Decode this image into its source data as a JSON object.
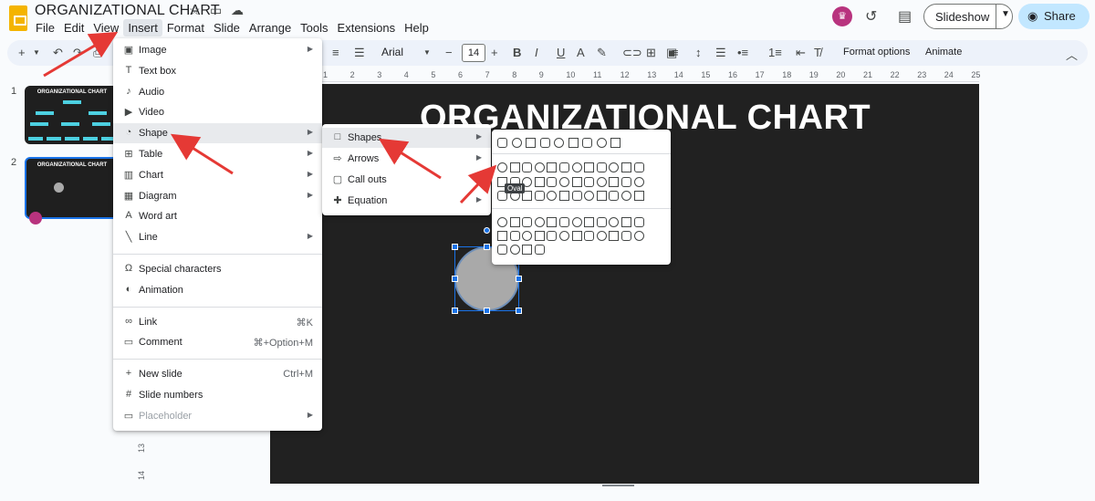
{
  "app": {
    "title": "ORGANIZATIONAL CHART",
    "menu": [
      "File",
      "Edit",
      "View",
      "Insert",
      "Format",
      "Slide",
      "Arrange",
      "Tools",
      "Extensions",
      "Help"
    ],
    "slideshow_label": "Slideshow",
    "share_label": "Share"
  },
  "toolbar": {
    "font": "Arial",
    "font_size": "14",
    "format_options": "Format options",
    "animate": "Animate"
  },
  "rulers": {
    "horizontal": [
      "1",
      "2",
      "3",
      "4",
      "5",
      "6",
      "7",
      "8",
      "9",
      "10",
      "11",
      "12",
      "13",
      "14",
      "15",
      "16",
      "17",
      "18",
      "19",
      "20",
      "21",
      "22",
      "23",
      "24",
      "25"
    ],
    "vertical": [
      "13",
      "14"
    ]
  },
  "filmstrip": {
    "slides": [
      {
        "number": "1",
        "title": "ORGANIZATIONAL CHART"
      },
      {
        "number": "2",
        "title": "ORGANIZATIONAL CHART"
      }
    ]
  },
  "slide": {
    "title": "ORGANIZATIONAL CHART"
  },
  "insert_menu": {
    "groups": [
      [
        {
          "label": "Image",
          "icon": "image-icon",
          "submenu": true
        },
        {
          "label": "Text box",
          "icon": "text-box-icon"
        },
        {
          "label": "Audio",
          "icon": "audio-icon"
        },
        {
          "label": "Video",
          "icon": "video-icon"
        },
        {
          "label": "Shape",
          "icon": "shape-icon",
          "submenu": true,
          "highlighted": true
        },
        {
          "label": "Table",
          "icon": "table-icon",
          "submenu": true
        },
        {
          "label": "Chart",
          "icon": "chart-icon",
          "submenu": true
        },
        {
          "label": "Diagram",
          "icon": "diagram-icon",
          "submenu": true
        },
        {
          "label": "Word art",
          "icon": "word-art-icon"
        },
        {
          "label": "Line",
          "icon": "line-icon",
          "submenu": true
        }
      ],
      [
        {
          "label": "Special characters",
          "icon": "omega-icon"
        },
        {
          "label": "Animation",
          "icon": "animation-icon"
        }
      ],
      [
        {
          "label": "Link",
          "icon": "link-icon",
          "shortcut": "⌘K"
        },
        {
          "label": "Comment",
          "icon": "comment-icon",
          "shortcut": "⌘+Option+M"
        }
      ],
      [
        {
          "label": "New slide",
          "icon": "plus-icon",
          "shortcut": "Ctrl+M"
        },
        {
          "label": "Slide numbers",
          "icon": "hash-icon"
        },
        {
          "label": "Placeholder",
          "icon": "placeholder-icon",
          "submenu": true,
          "disabled": true
        }
      ]
    ]
  },
  "shape_submenu": [
    {
      "label": "Shapes",
      "icon": "square-icon",
      "submenu": true,
      "highlighted": true
    },
    {
      "label": "Arrows",
      "icon": "arrow-icon",
      "submenu": true
    },
    {
      "label": "Call outs",
      "icon": "callout-icon",
      "submenu": true
    },
    {
      "label": "Equation",
      "icon": "equation-icon",
      "submenu": true
    }
  ],
  "shapes_palette": {
    "tooltip": "Oval"
  },
  "colors": {
    "accent": "#1a73e8",
    "annotation_arrow": "#e53935",
    "slide_bg": "#212121",
    "share_bg": "#c2e7ff"
  }
}
